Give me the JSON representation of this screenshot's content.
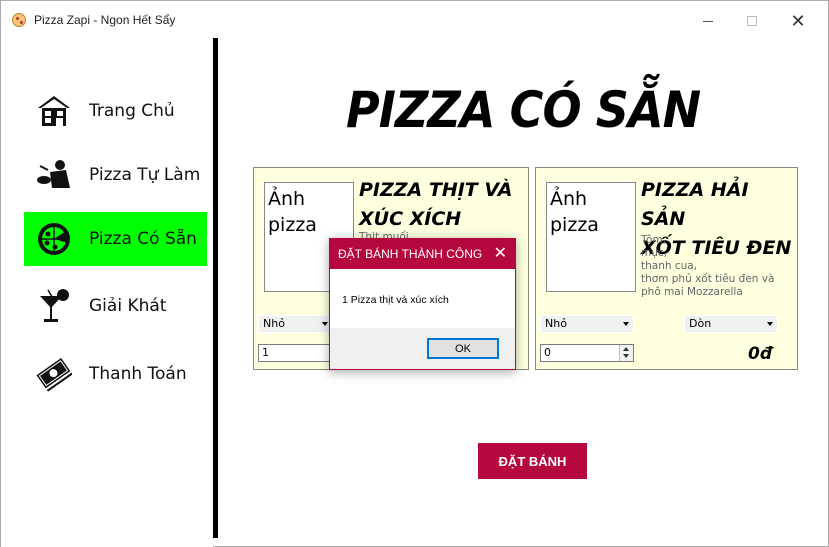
{
  "window": {
    "title": "Pizza Zapi - Ngon Hết Sẩy"
  },
  "sidebar": {
    "items": [
      {
        "label": "Trang Chủ",
        "icon": "house-icon"
      },
      {
        "label": "Pizza Tự Làm",
        "icon": "chef-icon"
      },
      {
        "label": "Pizza Có Sẵn",
        "icon": "pizza-icon",
        "active": true
      },
      {
        "label": "Giải Khát",
        "icon": "cocktail-icon"
      },
      {
        "label": "Thanh Toán",
        "icon": "money-icon"
      }
    ],
    "active_color": "#00ff00"
  },
  "main": {
    "heading": "PIZZA CÓ SẴN",
    "cards": [
      {
        "image_placeholder": "Ảnh pizza",
        "title_line1": "PIZZA THỊT VÀ",
        "title_line2": "XÚC XÍCH",
        "desc": "Thịt muối,",
        "size": "Nhỏ",
        "quantity": "1"
      },
      {
        "image_placeholder": "Ảnh pizza",
        "title_line1": "PIZZA HẢI SẢN",
        "title_line2": "XỐT TIÊU ĐEN",
        "desc_lines": [
          "Tôm,",
          "mực,",
          "thanh cua,",
          "thơm phủ xốt tiêu đen và",
          "phô mai Mozzarella"
        ],
        "size": "Nhỏ",
        "crust": "Dòn",
        "quantity": "0",
        "price": "0đ"
      }
    ],
    "order_button": "ĐẶT BÁNH",
    "accent_color": "#b5083f",
    "card_bg": "#ffffe0"
  },
  "dialog": {
    "title": "ĐẶT BÁNH THÀNH CÔNG",
    "message": "1 Pizza thịt và xúc xích",
    "ok_label": "OK"
  }
}
